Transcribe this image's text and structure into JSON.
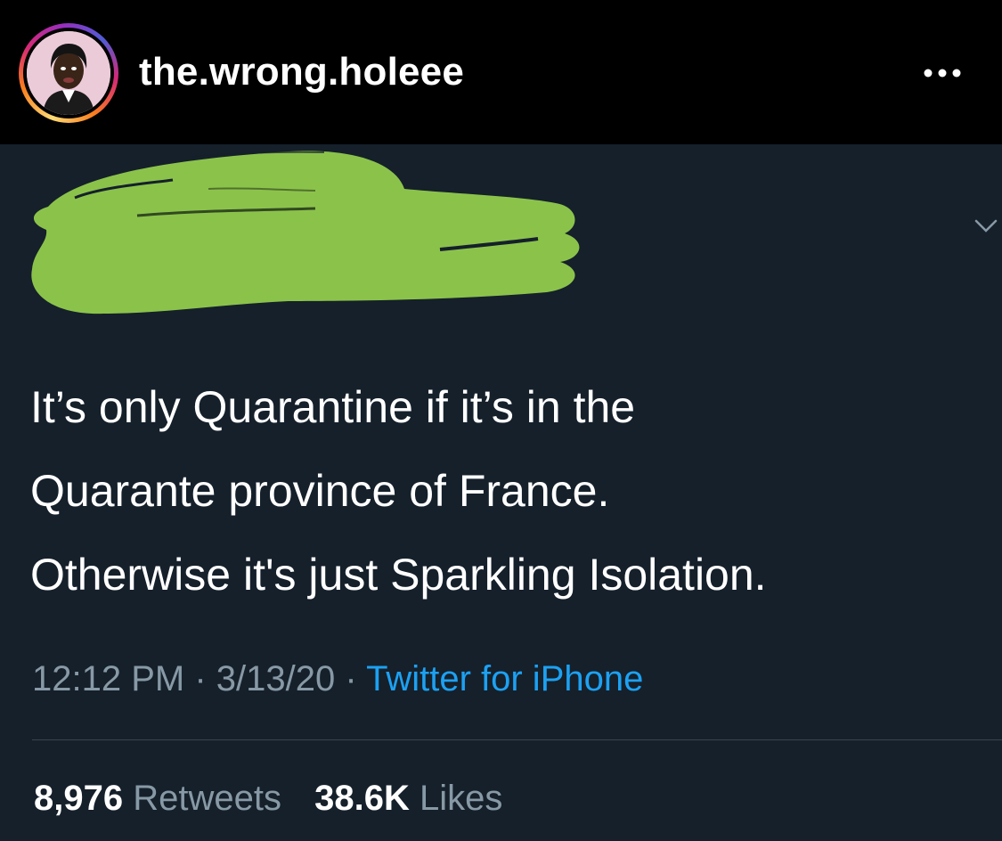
{
  "post": {
    "username": "the.wrong.holeee",
    "avatar_icon": "profile-photo-icon",
    "more_icon": "more-options-icon"
  },
  "tweet": {
    "lines": [
      "It’s only Quarantine if it’s in the",
      "Quarante province of France.",
      "Otherwise it's just Sparkling Isolation."
    ],
    "time": "12:12 PM",
    "date": "3/13/20",
    "separator": "·",
    "source": "Twitter for iPhone",
    "retweets_count": "8,976",
    "retweets_label": "Retweets",
    "likes_count": "38.6K",
    "likes_label": "Likes",
    "chevron_icon": "chevron-down-icon"
  },
  "colors": {
    "tweet_background": "#15202b",
    "redaction_green": "#8bc34a",
    "link_blue": "#1da1f2",
    "muted_text": "#8899a6"
  }
}
